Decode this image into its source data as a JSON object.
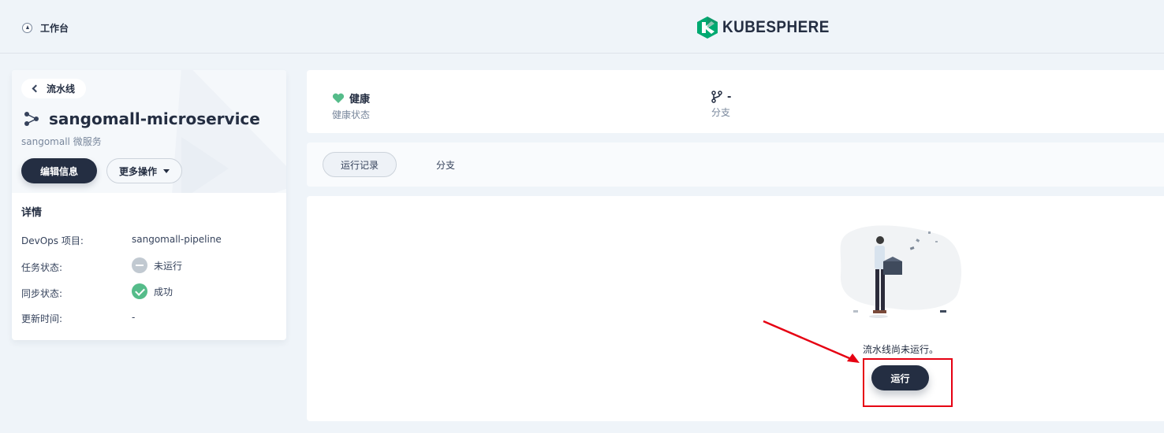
{
  "topbar": {
    "workbench_label": "工作台",
    "logo_text": "KUBESPHERE",
    "workbench_icon": "compass-icon",
    "logo_icon": "kubesphere-logo-icon"
  },
  "sidebar": {
    "back_label": "流水线",
    "title": "sangomall-microservice",
    "subtitle": "sangomall 微服务",
    "edit_label": "编辑信息",
    "more_label": "更多操作",
    "details_title": "详情",
    "details": [
      {
        "label": "DevOps 项目:",
        "value": "sangomall-pipeline"
      },
      {
        "label": "任务状态:",
        "value": "未运行"
      },
      {
        "label": "同步状态:",
        "value": "成功"
      },
      {
        "label": "更新时间:",
        "value": "-"
      }
    ]
  },
  "status": {
    "health_value": "健康",
    "health_label": "健康状态",
    "branch_value": "-",
    "branch_label": "分支"
  },
  "tabs": [
    {
      "label": "运行记录",
      "active": true
    },
    {
      "label": "分支",
      "active": false
    }
  ],
  "empty": {
    "message": "流水线尚未运行。",
    "run_label": "运行"
  },
  "colors": {
    "primary": "#242e42",
    "success": "#55bc8a",
    "annotation": "#e60012",
    "logo_green": "#00a971"
  }
}
